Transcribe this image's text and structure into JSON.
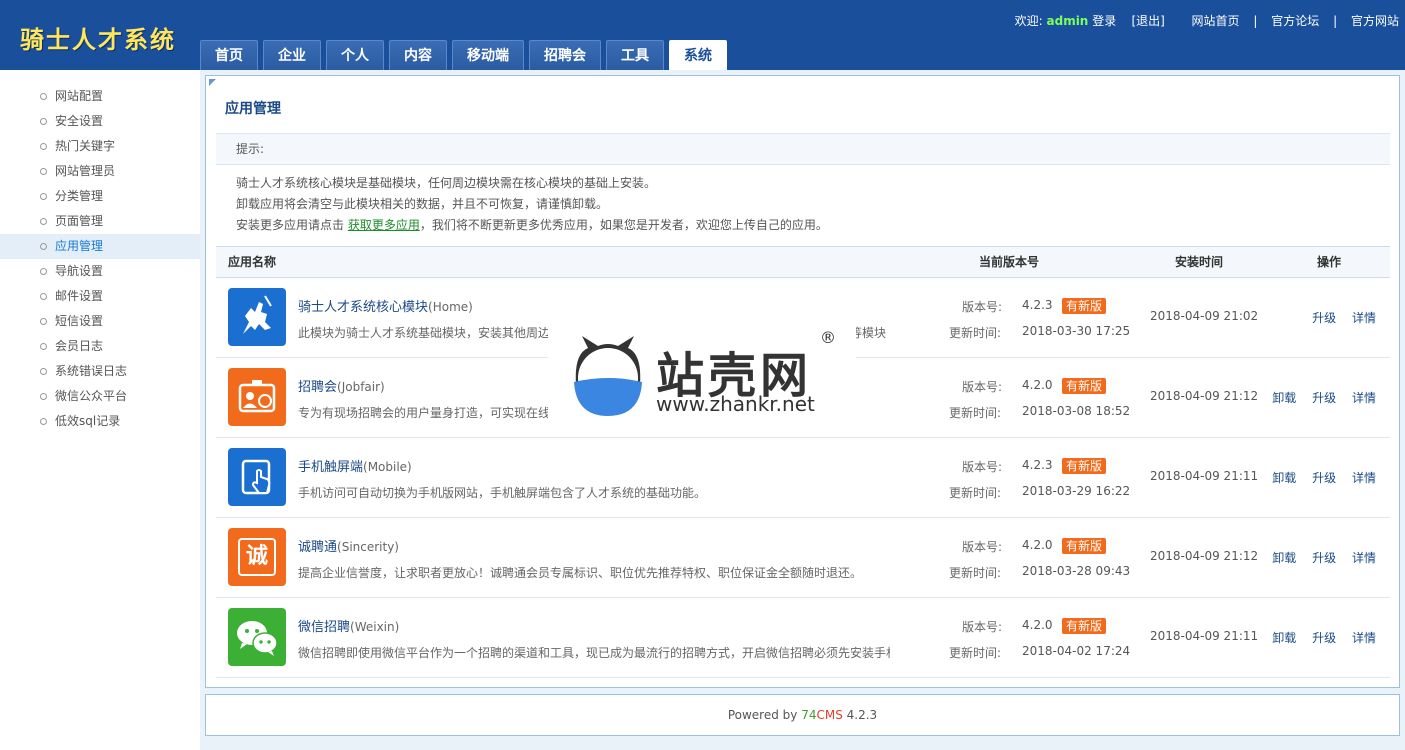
{
  "header": {
    "logo": "骑士人才系统",
    "welcome": "欢迎:",
    "username": "admin",
    "login": "登录",
    "logout": "[退出]",
    "links": [
      "网站首页",
      "官方论坛",
      "官方网站"
    ],
    "separators": [
      "|",
      "|"
    ]
  },
  "nav": {
    "tabs": [
      "首页",
      "企业",
      "个人",
      "内容",
      "移动端",
      "招聘会",
      "工具",
      "系统"
    ],
    "active": "系统"
  },
  "sidebar": {
    "items": [
      "网站配置",
      "安全设置",
      "热门关键字",
      "网站管理员",
      "分类管理",
      "页面管理",
      "应用管理",
      "导航设置",
      "邮件设置",
      "短信设置",
      "会员日志",
      "系统错误日志",
      "微信公众平台",
      "低效sql记录"
    ],
    "active": "应用管理"
  },
  "main": {
    "title": "应用管理",
    "tip_label": "提示:",
    "tips": {
      "line1": "骑士人才系统核心模块是基础模块，任何周边模块需在核心模块的基础上安装。",
      "line2": "卸载应用将会清空与此模块相关的数据，并且不可恢复，请谨慎卸载。",
      "line3_pre": "安装更多应用请点击 ",
      "line3_link": "获取更多应用",
      "line3_post": "，我们将不断更新更多优秀应用，如果您是开发者，欢迎您上传自己的应用。"
    },
    "columns": {
      "name": "应用名称",
      "version": "当前版本号",
      "install_time": "安装时间",
      "actions": "操作"
    },
    "version_label": "版本号:",
    "update_label": "更新时间:",
    "badge": "有新版",
    "apps": [
      {
        "name": "骑士人才系统核心模块",
        "en": "(Home)",
        "desc": "此模块为骑士人才系统基础模块，安装其他周边模块需在核心模块的基础上安装，求职者、招聘方、求职等模块",
        "version": "4.2.3",
        "updated": "2018-03-30 17:25",
        "installed": "2018-04-09 21:02",
        "actions": [
          "升级",
          "详情"
        ],
        "icon": "knight-icon",
        "color": "#1a6fd1"
      },
      {
        "name": "招聘会",
        "en": "(Jobfair)",
        "desc": "专为有现场招聘会的用户量身打造，可实现在线预定展位、招聘会管理等功能。",
        "version": "4.2.0",
        "updated": "2018-03-08 18:52",
        "installed": "2018-04-09 21:12",
        "actions": [
          "卸载",
          "升级",
          "详情"
        ],
        "icon": "jobfair-icon",
        "color": "#f26a1b"
      },
      {
        "name": "手机触屏端",
        "en": "(Mobile)",
        "desc": "手机访问可自动切换为手机版网站，手机触屏端包含了人才系统的基础功能。",
        "version": "4.2.3",
        "updated": "2018-03-29 16:22",
        "installed": "2018-04-09 21:11",
        "actions": [
          "卸载",
          "升级",
          "详情"
        ],
        "icon": "tablet-icon",
        "color": "#1a6fd1"
      },
      {
        "name": "诚聘通",
        "en": "(Sincerity)",
        "desc": "提高企业信誉度，让求职者更放心！诚聘通会员专属标识、职位优先推荐特权、职位保证金全额随时退还。",
        "version": "4.2.0",
        "updated": "2018-03-28 09:43",
        "installed": "2018-04-09 21:12",
        "actions": [
          "卸载",
          "升级",
          "详情"
        ],
        "icon": "sincerity-icon",
        "color": "#f26a1b"
      },
      {
        "name": "微信招聘",
        "en": "(Weixin)",
        "desc": "微信招聘即使用微信平台作为一个招聘的渠道和工具，现已成为最流行的招聘方式，开启微信招聘必须先安装手机触屏端",
        "version": "4.2.0",
        "updated": "2018-04-02 17:24",
        "installed": "2018-04-09 21:11",
        "actions": [
          "卸载",
          "升级",
          "详情"
        ],
        "icon": "wechat-icon",
        "color": "#3cb034"
      }
    ],
    "icon_chars": {
      "sincerity": "诚"
    }
  },
  "watermark": {
    "text": "站壳网",
    "url": "www.zhankr.net",
    "reg": "®"
  },
  "footer": {
    "prefix": "Powered by ",
    "brand1": "74",
    "brand2": "CMS",
    "version": " 4.2.3"
  }
}
